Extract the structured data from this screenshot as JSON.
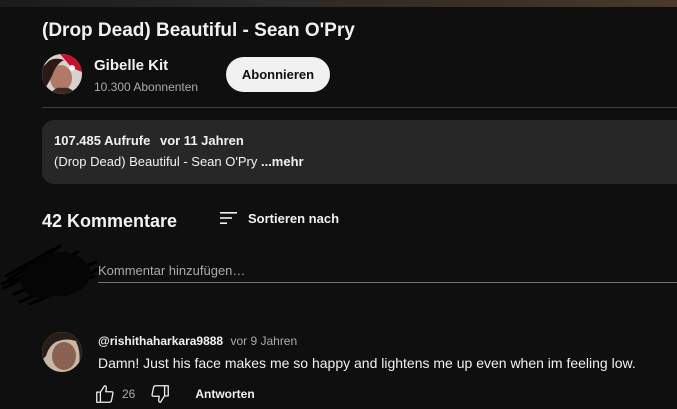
{
  "video": {
    "title": "(Drop Dead) Beautiful - Sean O'Pry"
  },
  "channel": {
    "name": "Gibelle Kit",
    "subscribers": "10.300 Abonnenten",
    "subscribe_label": "Abonnieren"
  },
  "description": {
    "views": "107.485 Aufrufe",
    "age": "vor 11 Jahren",
    "text": "(Drop Dead) Beautiful - Sean O'Pry ",
    "more_label": "...mehr"
  },
  "comments": {
    "count_label": "42 Kommentare",
    "sort_label": "Sortieren nach",
    "input_placeholder": "Kommentar hinzufügen…",
    "items": [
      {
        "author": "@rishithaharkara9888",
        "time": "vor 9 Jahren",
        "text": "Damn! Just his face makes me so happy and lightens me up even when im feeling low.",
        "likes": "26",
        "reply_label": "Antworten"
      }
    ]
  },
  "icons": {
    "sort": "sort-icon",
    "like": "thumbs-up-icon",
    "dislike": "thumbs-down-icon"
  },
  "colors": {
    "background": "#0f0f0f",
    "surface": "#272727",
    "text": "#f1f1f1",
    "muted": "#aaaaaa",
    "button_bg": "#f1f1f1"
  }
}
